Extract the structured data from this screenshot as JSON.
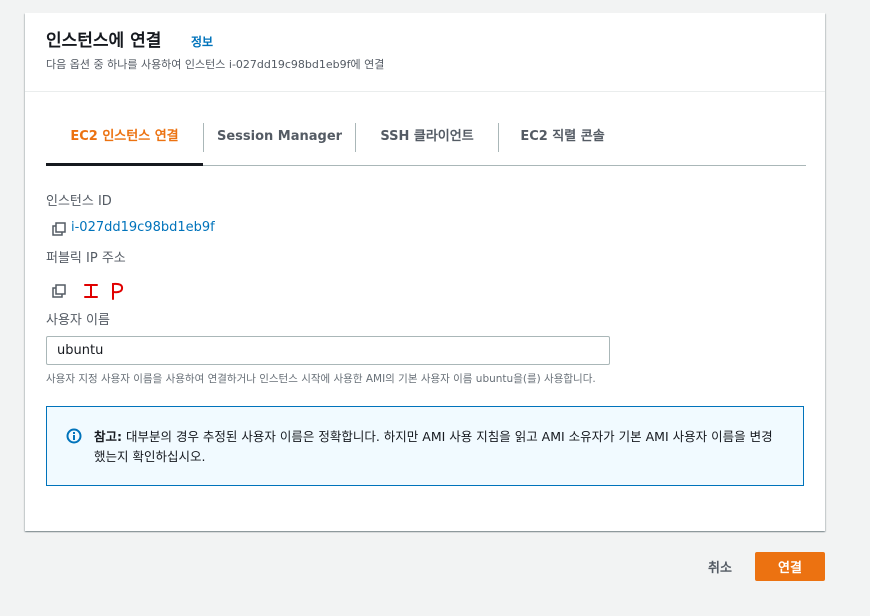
{
  "header": {
    "title": "인스턴스에 연결",
    "info_link": "정보",
    "subtitle": "다음 옵션 중 하나를 사용하여 인스턴스 i-027dd19c98bd1eb9f에 연결"
  },
  "tabs": [
    {
      "label": "EC2 인스턴스 연결",
      "active": true
    },
    {
      "label": "Session Manager",
      "active": false
    },
    {
      "label": "SSH 클라이언트",
      "active": false
    },
    {
      "label": "EC2 직렬 콘솔",
      "active": false
    }
  ],
  "instance": {
    "label": "인스턴스 ID",
    "value": "i-027dd19c98bd1eb9f"
  },
  "public_ip": {
    "label": "퍼블릭 IP 주소",
    "value_annotation": "I P"
  },
  "username": {
    "label": "사용자 이름",
    "value": "ubuntu",
    "hint": "사용자 지정 사용자 이름을 사용하여 연결하거나 인스턴스 시작에 사용한 AMI의 기본 사용자 이름 ubuntu을(를) 사용합니다."
  },
  "alert": {
    "prefix": "참고:",
    "text": " 대부분의 경우 추정된 사용자 이름은 정확합니다. 하지만 AMI 사용 지침을 읽고 AMI 소유자가 기본 AMI 사용자 이름을 변경했는지 확인하십시오."
  },
  "footer": {
    "cancel_label": "취소",
    "connect_label": "연결"
  },
  "colors": {
    "accent": "#ec7211",
    "link": "#0073bb",
    "info_border": "#0073bb",
    "info_bg": "#f1faff",
    "annotation": "#e00000"
  },
  "icons": {
    "copy": "copy-icon",
    "info": "info-circle-icon"
  }
}
